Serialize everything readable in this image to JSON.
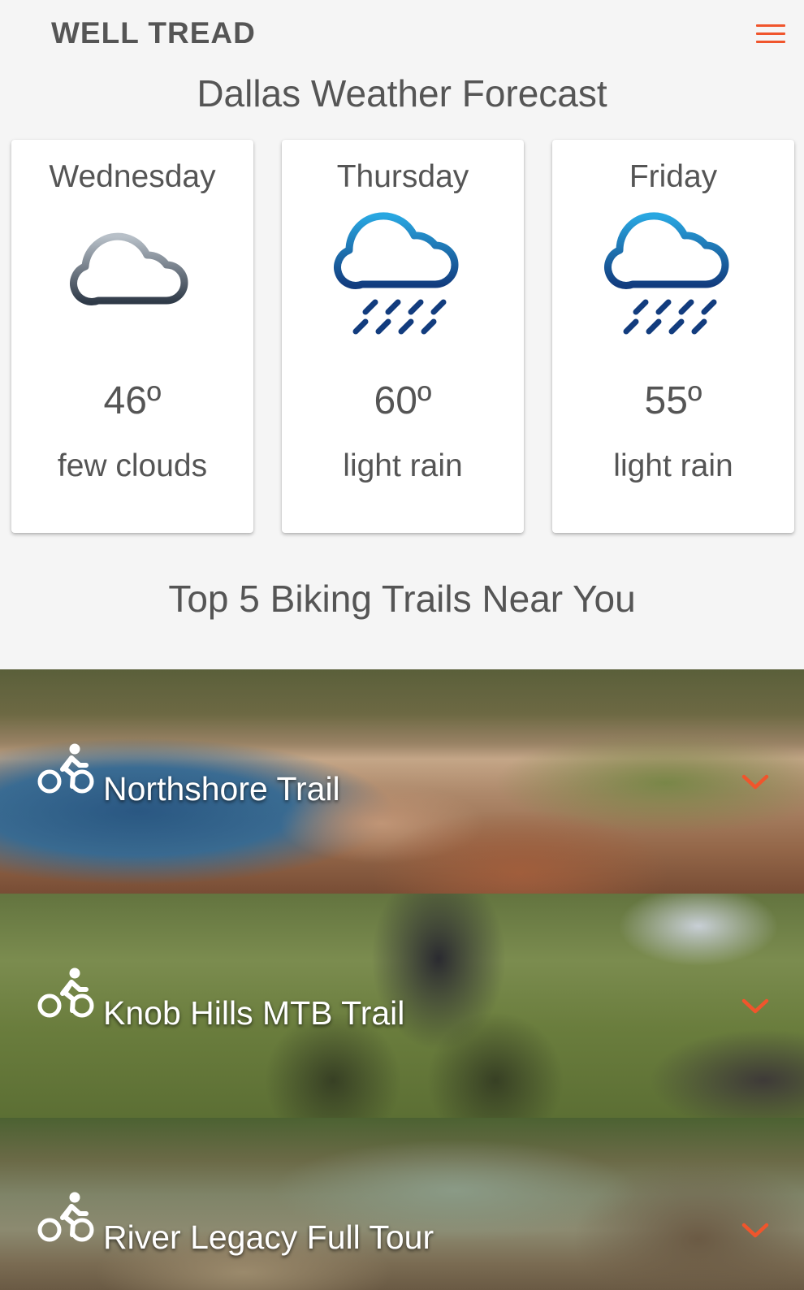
{
  "app": {
    "brand": "WELL TREAD",
    "menu_icon": "hamburger-menu-icon",
    "accent_color": "#f0552c"
  },
  "forecast": {
    "title": "Dallas Weather Forecast",
    "days": [
      {
        "day": "Wednesday",
        "temp": "46º",
        "condition": "few clouds",
        "icon": "cloud-icon"
      },
      {
        "day": "Thursday",
        "temp": "60º",
        "condition": "light rain",
        "icon": "rain-cloud-icon"
      },
      {
        "day": "Friday",
        "temp": "55º",
        "condition": "light rain",
        "icon": "rain-cloud-icon"
      }
    ]
  },
  "trails": {
    "title": "Top 5 Biking Trails Near You",
    "items": [
      {
        "name": "Northshore Trail",
        "icon": "bicycle-rider-icon",
        "expand_icon": "chevron-down-icon"
      },
      {
        "name": "Knob Hills MTB Trail",
        "icon": "bicycle-rider-icon",
        "expand_icon": "chevron-down-icon"
      },
      {
        "name": "River Legacy Full Tour",
        "icon": "bicycle-rider-icon",
        "expand_icon": "chevron-down-icon"
      }
    ]
  }
}
